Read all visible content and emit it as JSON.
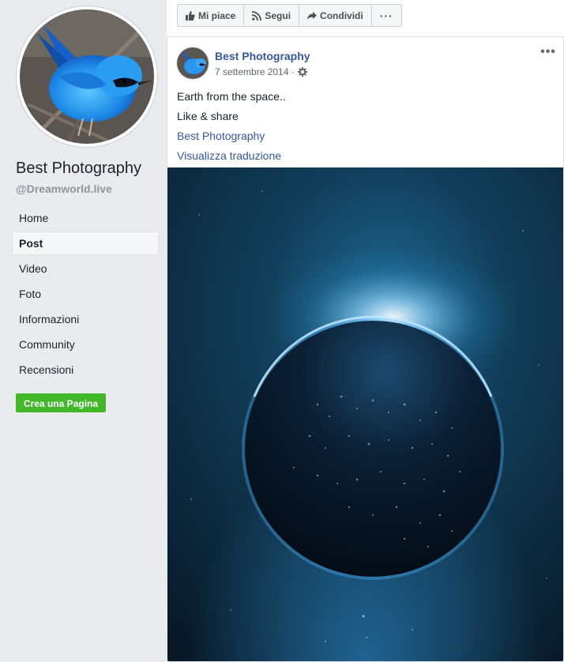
{
  "page": {
    "name": "Best Photography",
    "handle": "@Dreamworld.live"
  },
  "sidebar": {
    "items": [
      {
        "label": "Home",
        "active": false
      },
      {
        "label": "Post",
        "active": true
      },
      {
        "label": "Video",
        "active": false
      },
      {
        "label": "Foto",
        "active": false
      },
      {
        "label": "Informazioni",
        "active": false
      },
      {
        "label": "Community",
        "active": false
      },
      {
        "label": "Recensioni",
        "active": false
      }
    ],
    "create_page_label": "Crea una Pagina"
  },
  "action_bar": {
    "like_label": "Mi piace",
    "follow_label": "Segui",
    "share_label": "Condividi",
    "more_label": "···"
  },
  "post": {
    "author": "Best Photography",
    "date": "7 settembre 2014 ·",
    "menu_label": "•••",
    "lines": [
      "Earth from the space..",
      "Like & share"
    ],
    "link_text": "Best Photography",
    "translate_label": "Visualizza traduzione",
    "image_icon": "earth-from-space-photo"
  },
  "colors": {
    "link": "#365899",
    "background": "#e9ebee",
    "green_button": "#42b72a",
    "bird_blue": "#1e90e8"
  }
}
